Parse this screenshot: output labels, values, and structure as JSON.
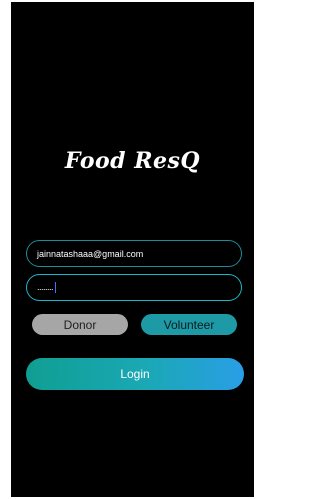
{
  "app": {
    "title": "Food ResQ"
  },
  "form": {
    "email_value": "jainnatashaaa@gmail.com",
    "password_masked": "........",
    "role_options": [
      "Donor",
      "Volunteer"
    ],
    "login_label": "Login"
  },
  "colors": {
    "background": "#000000",
    "accent": "#1aa8b5",
    "donor_bg": "#a6a6a6",
    "volunteer_bg": "#1e9aa6",
    "login_gradient_start": "#109e93",
    "login_gradient_end": "#2a9ee6"
  }
}
